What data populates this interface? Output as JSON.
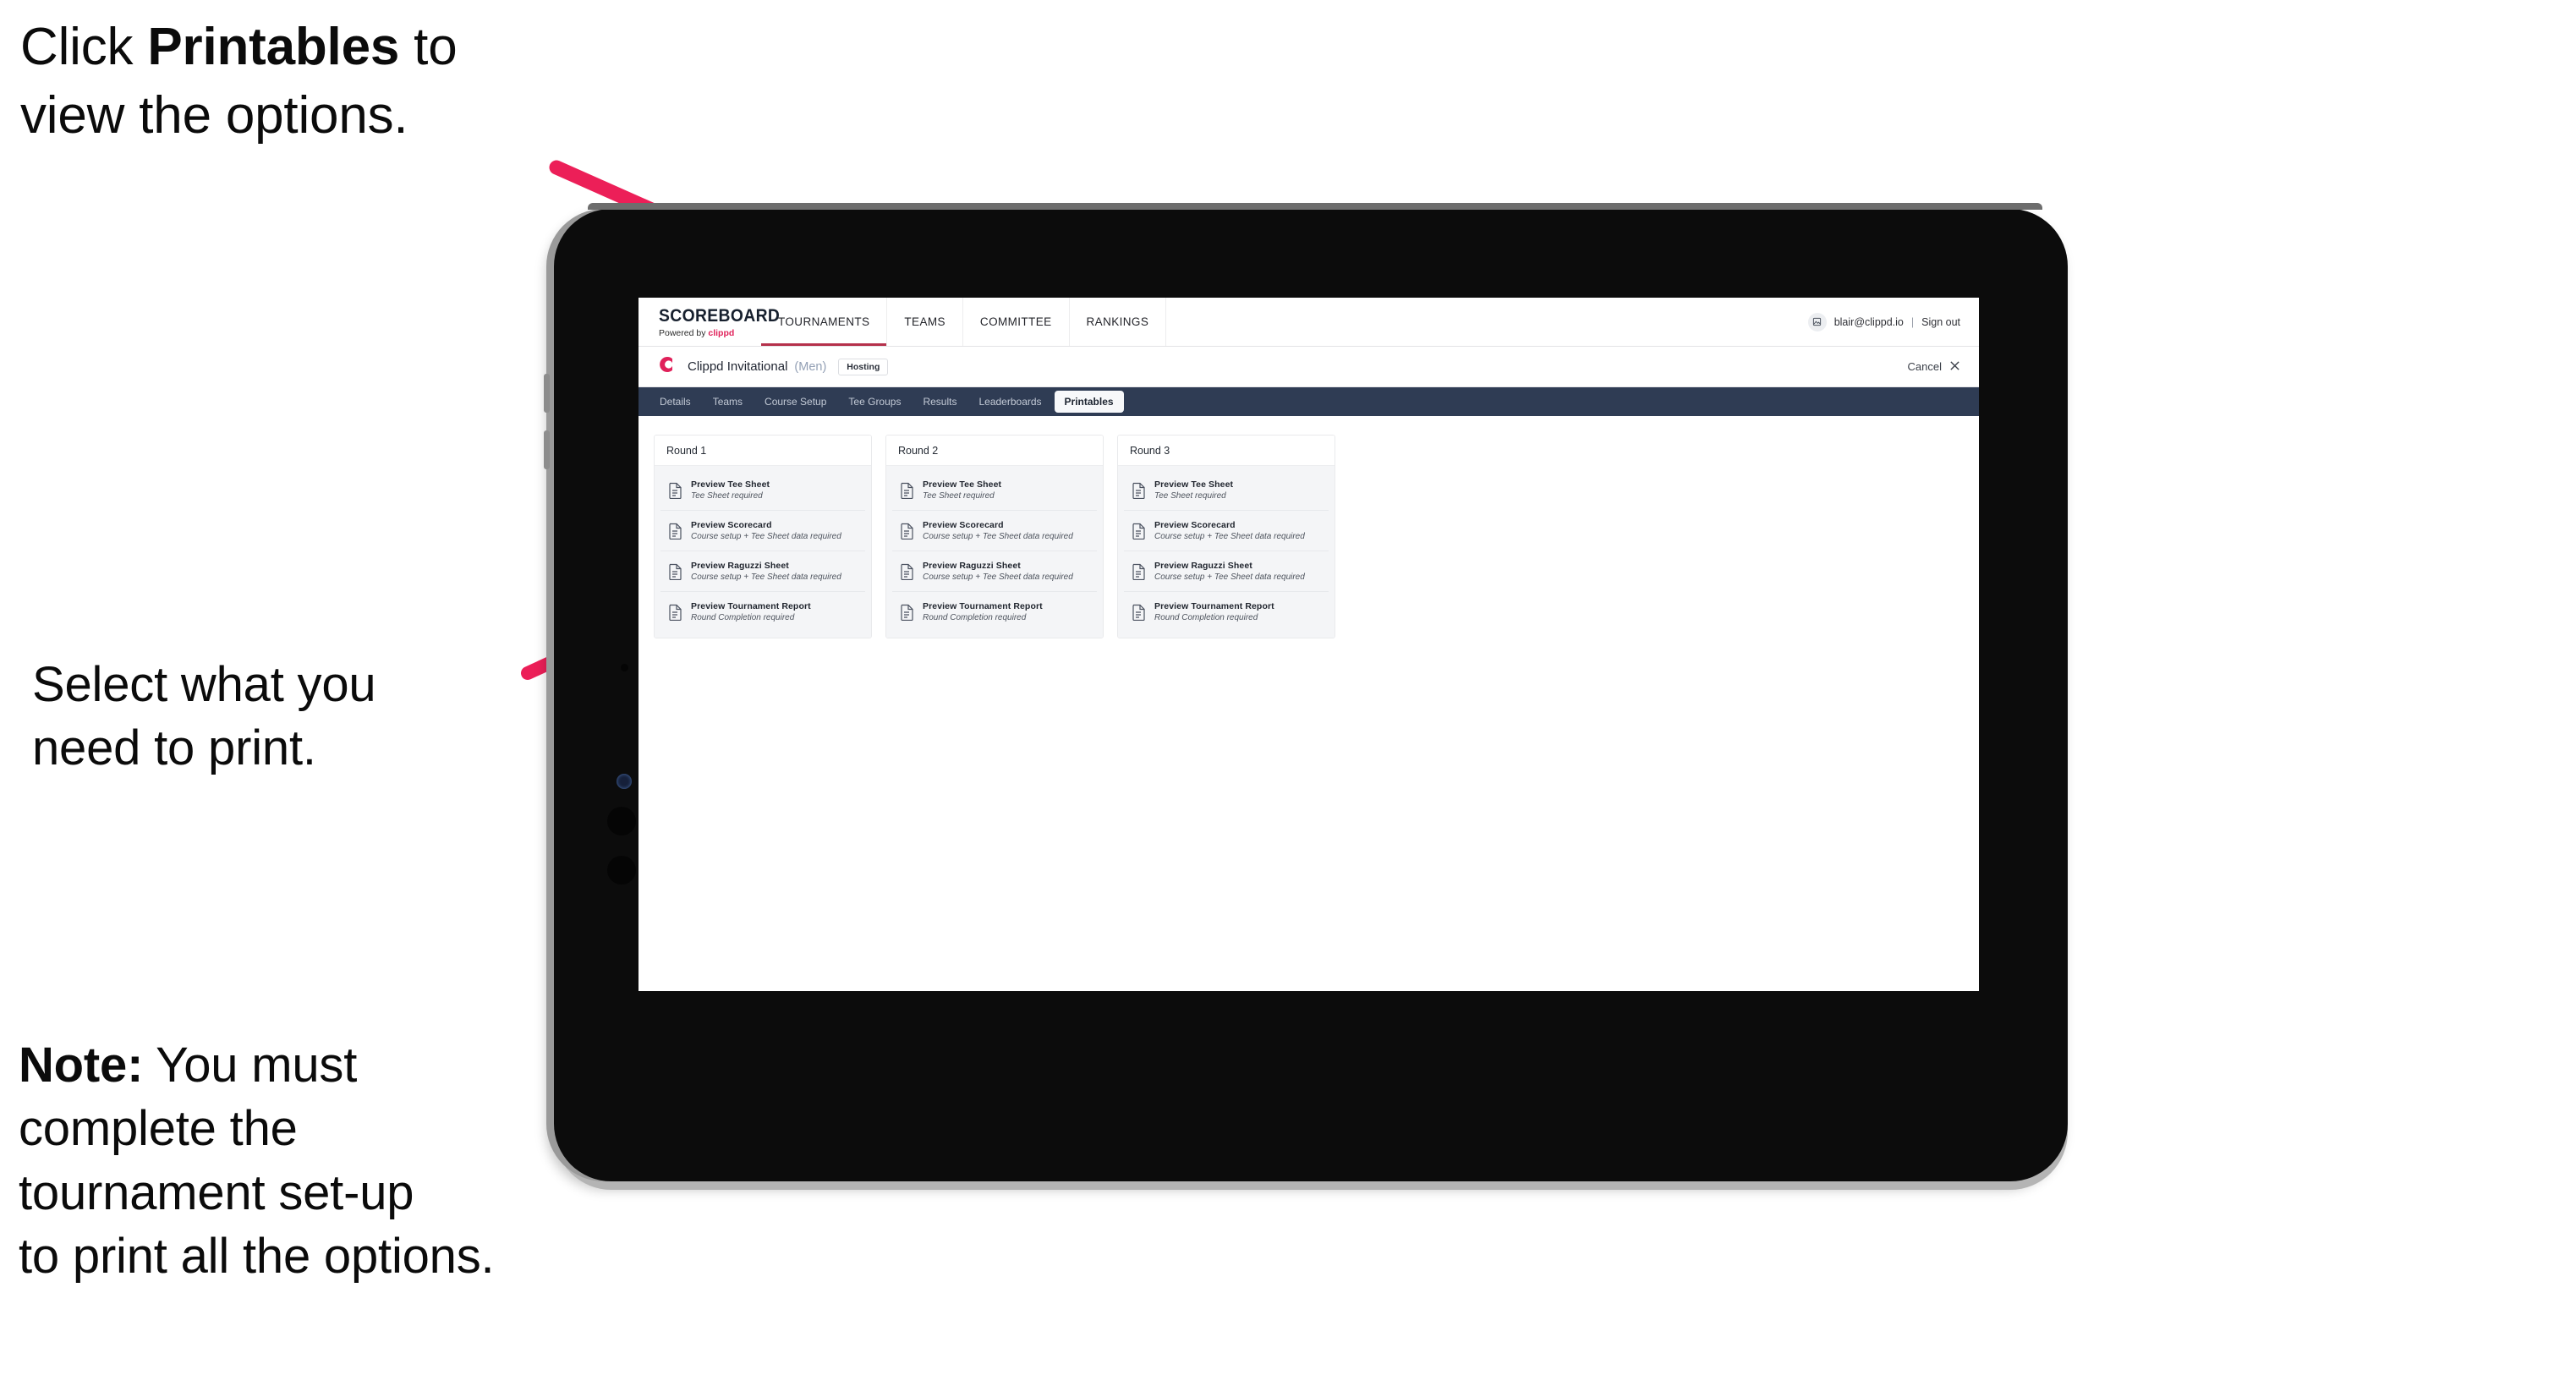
{
  "annotations": [
    {
      "id": "annot-1",
      "prefix": "Click ",
      "bold": "Printables",
      "suffix": " to\nview the options."
    },
    {
      "id": "annot-2",
      "prefix": "",
      "bold": "",
      "suffix": "Select what you\n need to print."
    },
    {
      "id": "annot-3",
      "prefix": "",
      "bold": "Note:",
      "suffix": " You must\ncomplete the\ntournament set-up\nto print all the options."
    }
  ],
  "arrow_color": "#ec1f58",
  "app": {
    "brand": {
      "title": "SCOREBOARD",
      "powered_prefix": "Powered by ",
      "powered_name": "clippd"
    },
    "top_nav": [
      {
        "label": "TOURNAMENTS",
        "active": true
      },
      {
        "label": "TEAMS",
        "active": false
      },
      {
        "label": "COMMITTEE",
        "active": false
      },
      {
        "label": "RANKINGS",
        "active": false
      }
    ],
    "account": {
      "avatar_icon": "user-avatar-icon",
      "email": "blair@clippd.io",
      "separator": "|",
      "sign_out": "Sign out"
    },
    "tournament": {
      "logo": "C",
      "name": "Clippd Invitational",
      "gender": "(Men)",
      "status_badge": "Hosting",
      "cancel_label": "Cancel",
      "cancel_icon": "close-icon"
    },
    "sub_nav": [
      {
        "label": "Details",
        "active": false
      },
      {
        "label": "Teams",
        "active": false
      },
      {
        "label": "Course Setup",
        "active": false
      },
      {
        "label": "Tee Groups",
        "active": false
      },
      {
        "label": "Results",
        "active": false
      },
      {
        "label": "Leaderboards",
        "active": false
      },
      {
        "label": "Printables",
        "active": true
      }
    ],
    "rounds": [
      {
        "heading": "Round 1",
        "items": [
          {
            "title": "Preview Tee Sheet",
            "subtitle": "Tee Sheet required"
          },
          {
            "title": "Preview Scorecard",
            "subtitle": "Course setup + Tee Sheet data required"
          },
          {
            "title": "Preview Raguzzi Sheet",
            "subtitle": "Course setup + Tee Sheet data required"
          },
          {
            "title": "Preview Tournament Report",
            "subtitle": "Round Completion required"
          }
        ]
      },
      {
        "heading": "Round 2",
        "items": [
          {
            "title": "Preview Tee Sheet",
            "subtitle": "Tee Sheet required"
          },
          {
            "title": "Preview Scorecard",
            "subtitle": "Course setup + Tee Sheet data required"
          },
          {
            "title": "Preview Raguzzi Sheet",
            "subtitle": "Course setup + Tee Sheet data required"
          },
          {
            "title": "Preview Tournament Report",
            "subtitle": "Round Completion required"
          }
        ]
      },
      {
        "heading": "Round 3",
        "items": [
          {
            "title": "Preview Tee Sheet",
            "subtitle": "Tee Sheet required"
          },
          {
            "title": "Preview Scorecard",
            "subtitle": "Course setup + Tee Sheet data required"
          },
          {
            "title": "Preview Raguzzi Sheet",
            "subtitle": "Course setup + Tee Sheet data required"
          },
          {
            "title": "Preview Tournament Report",
            "subtitle": "Round Completion required"
          }
        ]
      }
    ]
  },
  "colors": {
    "accent_pink": "#e0215a",
    "subnav_navy": "#2f3c54",
    "active_tab_underline": "#b5314b",
    "annotation_arrow": "#ec1f58"
  }
}
